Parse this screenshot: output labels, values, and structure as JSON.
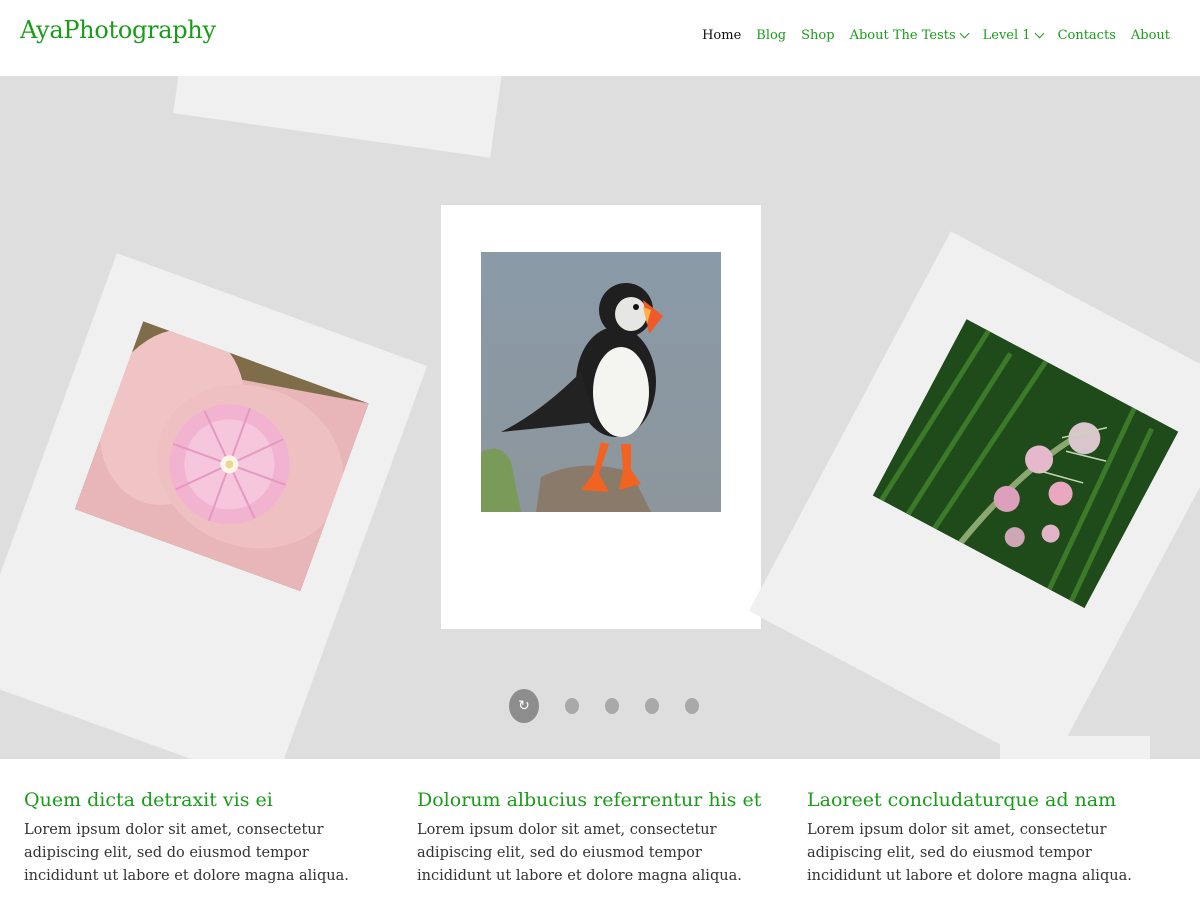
{
  "site": {
    "logo": "AyaPhotography"
  },
  "nav": {
    "items": [
      {
        "label": "Home",
        "active": true,
        "dropdown": false
      },
      {
        "label": "Blog",
        "active": false,
        "dropdown": false
      },
      {
        "label": "Shop",
        "active": false,
        "dropdown": false
      },
      {
        "label": "About The Tests",
        "active": false,
        "dropdown": true
      },
      {
        "label": "Level 1",
        "active": false,
        "dropdown": true
      },
      {
        "label": "Contacts",
        "active": false,
        "dropdown": false
      },
      {
        "label": "About",
        "active": false,
        "dropdown": false
      }
    ]
  },
  "slider": {
    "slides": [
      "pink-flower",
      "puffin",
      "wildflowers"
    ],
    "active_index": 0,
    "dot_count": 5,
    "active_dot_icon": "replay-icon"
  },
  "features": [
    {
      "title": "Quem dicta detraxit vis ei",
      "text": "Lorem ipsum dolor sit amet, consectetur adipiscing elit, sed do eiusmod tempor incididunt ut labore et dolore magna aliqua."
    },
    {
      "title": "Dolorum albucius referrentur his et",
      "text": "Lorem ipsum dolor sit amet, consectetur adipiscing elit, sed do eiusmod tempor incididunt ut labore et dolore magna aliqua."
    },
    {
      "title": "Laoreet concludaturque ad nam",
      "text": "Lorem ipsum dolor sit amet, consectetur adipiscing elit, sed do eiusmod tempor incididunt ut labore et dolore magna aliqua."
    }
  ],
  "colors": {
    "accent": "#1a9c1a",
    "slider_bg": "#dedede",
    "card_bg": "#f0f0f0"
  }
}
